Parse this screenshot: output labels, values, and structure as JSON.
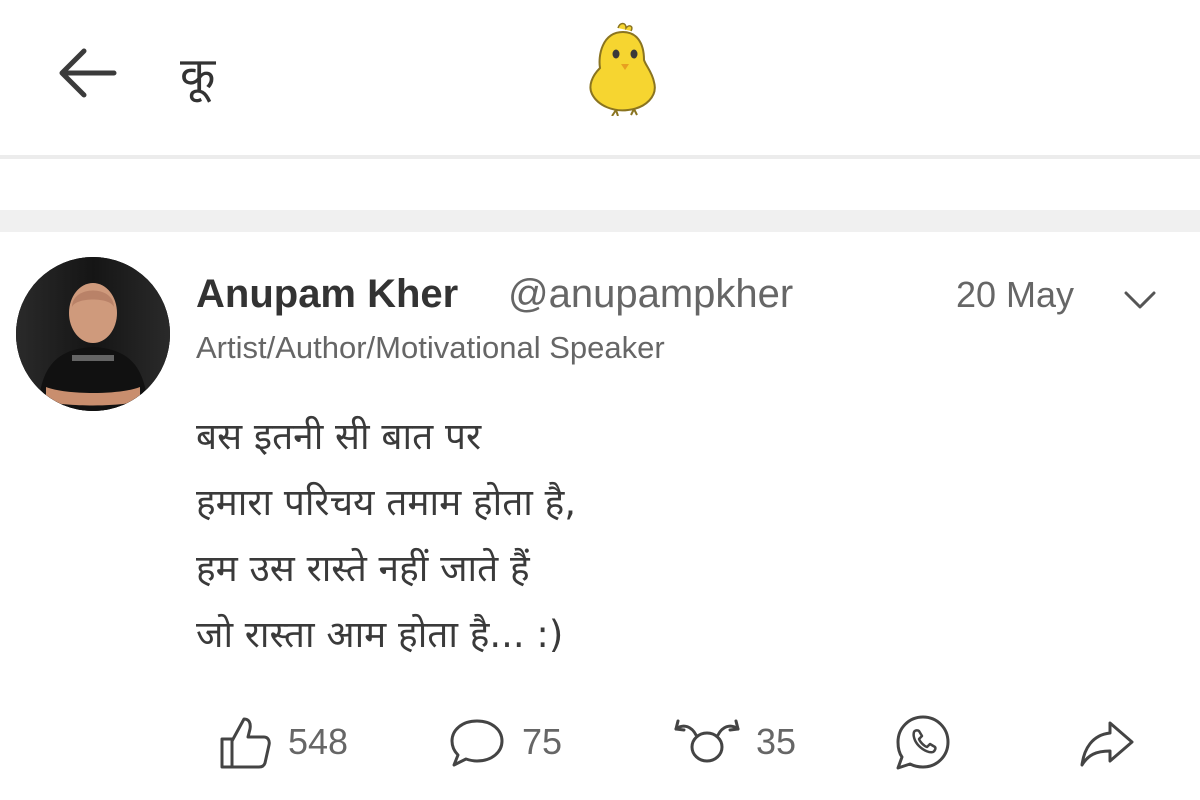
{
  "header": {
    "back_icon": "arrow-left-icon",
    "app_title": "कू",
    "logo_icon": "yellow-bird-logo"
  },
  "post": {
    "author_name": "Anupam Kher",
    "author_handle": "@anupampkher",
    "author_bio": "Artist/Author/Motivational Speaker",
    "date": "20 May",
    "menu_icon": "chevron-down-icon",
    "lines": [
      "बस इतनी सी बात पर",
      "हमारा परिचय तमाम होता है,",
      "हम उस रास्ते नहीं जाते हैं",
      "जो रास्ता आम होता है... :)"
    ],
    "actions": {
      "likes": "548",
      "comments": "75",
      "rekoos": "35",
      "like_icon": "thumbs-up-icon",
      "comment_icon": "speech-bubble-icon",
      "rekoo_icon": "rekoo-icon",
      "whatsapp_icon": "whatsapp-icon",
      "share_icon": "share-arrow-icon"
    }
  },
  "colors": {
    "text_primary": "#333333",
    "text_secondary": "#666666",
    "logo_yellow": "#f6d530",
    "divider": "#ececec"
  }
}
